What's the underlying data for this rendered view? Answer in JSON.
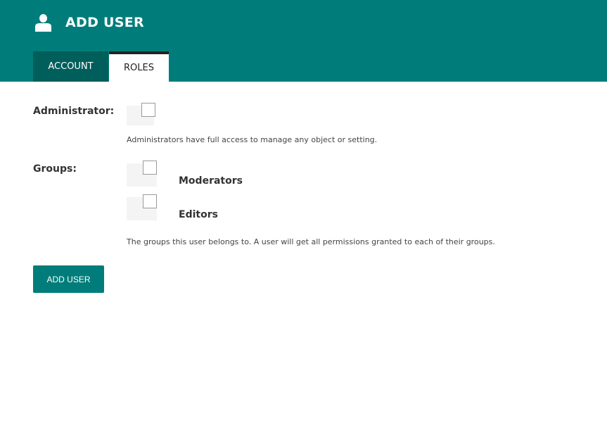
{
  "header": {
    "title": "ADD USER",
    "icon": "user-icon",
    "background": "#007d7a"
  },
  "tabs": [
    {
      "label": "ACCOUNT",
      "active": false
    },
    {
      "label": "ROLES",
      "active": true
    }
  ],
  "administrator": {
    "label": "Administrator:",
    "checked": false,
    "help": "Administrators have full access to manage any object or setting."
  },
  "groups": {
    "label": "Groups:",
    "options": [
      {
        "label": "Moderators",
        "checked": false
      },
      {
        "label": "Editors",
        "checked": false
      }
    ],
    "help": "The groups this user belongs to. A user will get all permissions granted to each of their groups."
  },
  "submit": {
    "label": "ADD USER"
  },
  "colors": {
    "accent": "#007d7a",
    "tab_inactive": "#005e5b"
  }
}
